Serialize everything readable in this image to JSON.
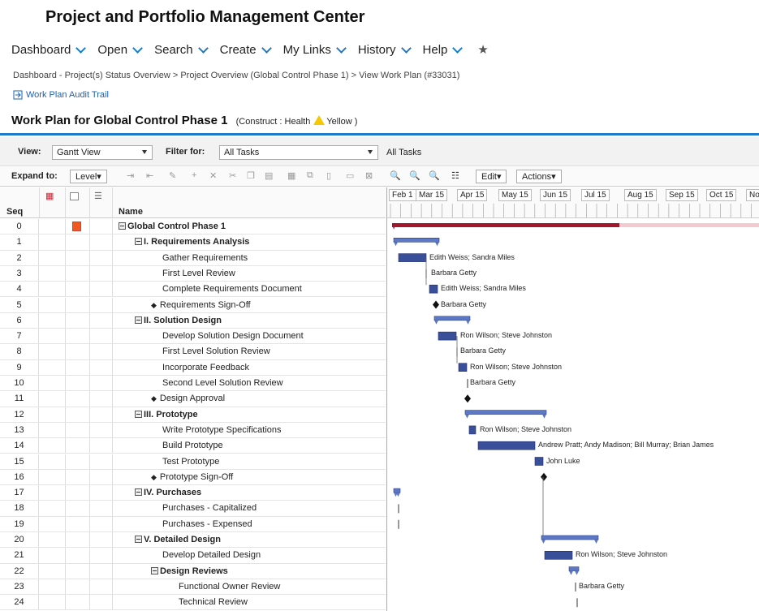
{
  "app": {
    "title": "Project and Portfolio Management Center"
  },
  "menu": [
    {
      "label": "Dashboard"
    },
    {
      "label": "Open"
    },
    {
      "label": "Search"
    },
    {
      "label": "Create"
    },
    {
      "label": "My Links"
    },
    {
      "label": "History"
    },
    {
      "label": "Help"
    }
  ],
  "breadcrumb": "Dashboard - Project(s) Status Overview > Project Overview (Global Control Phase 1) > View Work Plan (#33031)",
  "audit_link": "Work Plan Audit Trail",
  "workplan": {
    "title": "Work Plan for Global Control Phase 1",
    "construct": "(Construct : Health",
    "health": "Yellow )"
  },
  "filters": {
    "view_label": "View:",
    "view_value": "Gantt View",
    "filter_label": "Filter for:",
    "filter_value": "All Tasks",
    "filter_text": "All Tasks"
  },
  "toolbar": {
    "expand_label": "Expand to:",
    "level": "Level▾",
    "edit": "Edit▾",
    "actions": "Actions▾"
  },
  "grid": {
    "col_seq": "Seq",
    "col_name": "Name"
  },
  "months": [
    "Feb 1",
    "Mar 15",
    "Apr 15",
    "May 15",
    "Jun 15",
    "Jul 15",
    "Aug 15",
    "Sep 15",
    "Oct 15",
    "No"
  ],
  "tasks": [
    {
      "seq": "0",
      "name": "Global Control Phase 1",
      "level": 0,
      "summary": true,
      "res": ""
    },
    {
      "seq": "1",
      "name": "I. Requirements Analysis",
      "level": 1,
      "summary": true,
      "res": ""
    },
    {
      "seq": "2",
      "name": "Gather Requirements",
      "level": 2,
      "res": "Edith Weiss; Sandra Miles"
    },
    {
      "seq": "3",
      "name": "First Level Review",
      "level": 2,
      "res": "Barbara Getty"
    },
    {
      "seq": "4",
      "name": "Complete Requirements Document",
      "level": 2,
      "res": "Edith Weiss; Sandra Miles"
    },
    {
      "seq": "5",
      "name": "Requirements Sign-Off",
      "level": 2,
      "milestone": true,
      "res": "Barbara Getty"
    },
    {
      "seq": "6",
      "name": "II. Solution Design",
      "level": 1,
      "summary": true,
      "res": ""
    },
    {
      "seq": "7",
      "name": "Develop Solution Design Document",
      "level": 2,
      "res": "Ron Wilson; Steve Johnston"
    },
    {
      "seq": "8",
      "name": "First Level Solution Review",
      "level": 2,
      "res": "Barbara Getty"
    },
    {
      "seq": "9",
      "name": "Incorporate Feedback",
      "level": 2,
      "res": "Ron Wilson; Steve Johnston"
    },
    {
      "seq": "10",
      "name": "Second Level Solution Review",
      "level": 2,
      "res": "Barbara Getty"
    },
    {
      "seq": "11",
      "name": "Design Approval",
      "level": 2,
      "milestone": true,
      "res": ""
    },
    {
      "seq": "12",
      "name": "III. Prototype",
      "level": 1,
      "summary": true,
      "res": ""
    },
    {
      "seq": "13",
      "name": "Write Prototype Specifications",
      "level": 2,
      "res": "Ron Wilson; Steve Johnston"
    },
    {
      "seq": "14",
      "name": "Build Prototype",
      "level": 2,
      "res": "Andrew Pratt; Andy Madison; Bill Murray; Brian James"
    },
    {
      "seq": "15",
      "name": "Test Prototype",
      "level": 2,
      "res": "John Luke"
    },
    {
      "seq": "16",
      "name": "Prototype Sign-Off",
      "level": 2,
      "milestone": true,
      "res": ""
    },
    {
      "seq": "17",
      "name": "IV. Purchases",
      "level": 1,
      "summary": true,
      "res": ""
    },
    {
      "seq": "18",
      "name": "Purchases - Capitalized",
      "level": 2,
      "res": ""
    },
    {
      "seq": "19",
      "name": "Purchases - Expensed",
      "level": 2,
      "res": ""
    },
    {
      "seq": "20",
      "name": "V. Detailed Design",
      "level": 1,
      "summary": true,
      "res": ""
    },
    {
      "seq": "21",
      "name": "Develop Detailed Design",
      "level": 2,
      "res": "Ron Wilson; Steve Johnston"
    },
    {
      "seq": "22",
      "name": "Design Reviews",
      "level": 2,
      "summary": true,
      "res": ""
    },
    {
      "seq": "23",
      "name": "Functional Owner Review",
      "level": 3,
      "res": "Barbara Getty"
    },
    {
      "seq": "24",
      "name": "Technical Review",
      "level": 3,
      "res": ""
    }
  ],
  "colors": {
    "accent": "#1e7bc9",
    "bar": "#3a4f9a",
    "summary_bar": "#5d78c4",
    "project_bar": "#a3162b",
    "health": "#f5c800"
  }
}
